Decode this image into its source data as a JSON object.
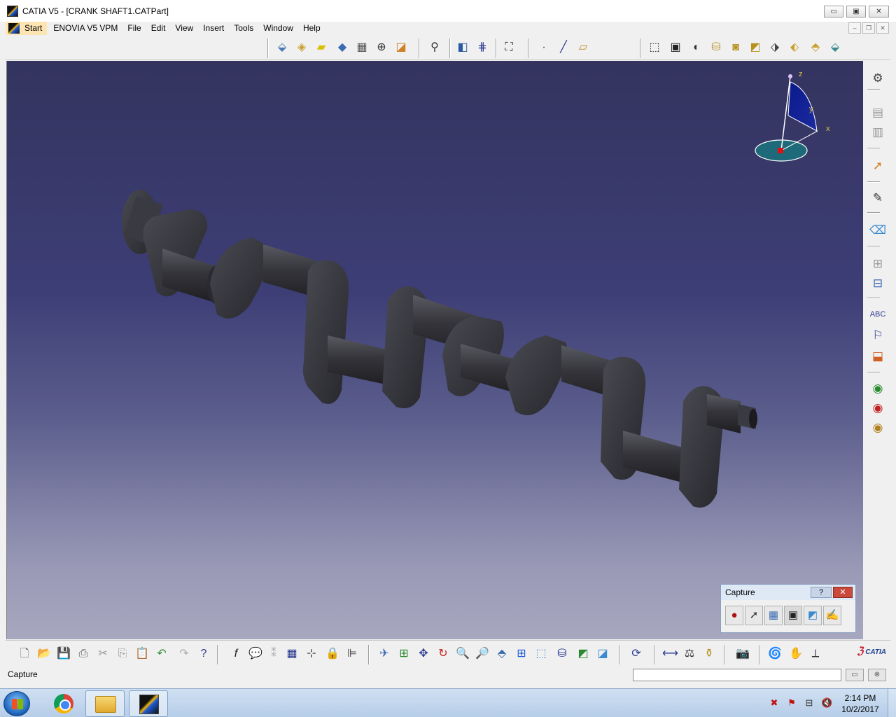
{
  "window": {
    "title": "CATIA V5 - [CRANK SHAFT1.CATPart]",
    "minimize_glyph": "▭",
    "maximize_glyph": "▣",
    "close_glyph": "✕"
  },
  "menu": {
    "items": [
      "Start",
      "ENOVIA V5 VPM",
      "File",
      "Edit",
      "View",
      "Insert",
      "Tools",
      "Window",
      "Help"
    ]
  },
  "compass": {
    "x_label": "x",
    "y_label": "y",
    "z_label": "z"
  },
  "capture": {
    "title": "Capture",
    "help_glyph": "?",
    "close_glyph": "✕"
  },
  "status": {
    "text": "Capture",
    "command_value": ""
  },
  "taskbar": {
    "time": "2:14 PM",
    "date": "10/2/2017"
  },
  "brand": {
    "name": "CATIA"
  },
  "colors": {
    "viewport_top": "#34345f",
    "viewport_bottom": "#a7a7bf",
    "shaft": "#3a3a40",
    "start_highlight": "#fde4b3"
  }
}
